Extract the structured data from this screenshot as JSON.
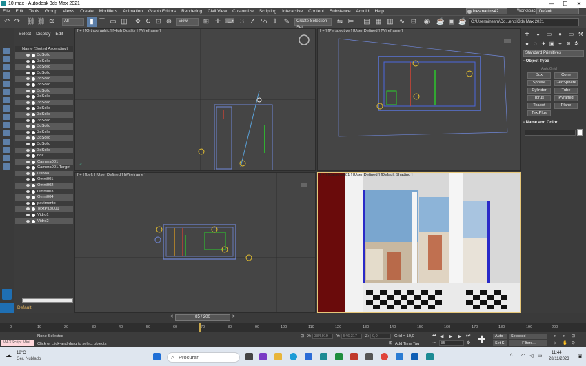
{
  "window": {
    "title": "10.max - Autodesk 3ds Max 2021",
    "minimize": "—",
    "maximize": "☐",
    "close": "✕"
  },
  "menu": [
    "File",
    "Edit",
    "Tools",
    "Group",
    "Views",
    "Create",
    "Modifiers",
    "Animation",
    "Graph Editors",
    "Rendering",
    "Civil View",
    "Customize",
    "Scripting",
    "Interactive",
    "Content",
    "Substance",
    "Arnold",
    "Help"
  ],
  "account": {
    "user": "inesmartins42",
    "workspaces_label": "Workspaces:",
    "workspace": "Default"
  },
  "toolbar": {
    "selection_filter": "All",
    "ref_coord": "View",
    "selection_set": "Create Selection Set",
    "project_path": "C:\\Users\\inesm\\Do...ents\\3ds Max 2021"
  },
  "explorer": {
    "tabs": [
      "Select",
      "Display",
      "Edit"
    ],
    "column_header": "Name (Sorted Ascending)",
    "items": [
      "3dSolid",
      "3dSolid",
      "3dSolid",
      "3dSolid",
      "3dSolid",
      "3dSolid",
      "3dSolid",
      "3dSolid",
      "3dSolid",
      "3dSolid",
      "3dSolid",
      "3dSolid",
      "3dSolid",
      "3dSolid",
      "3dSolid",
      "3dSolid",
      "3dSolid",
      "box",
      "Camera001",
      "Camera001.Target",
      "Lisboa",
      "Omni001",
      "Omni002",
      "Omni003",
      "Omni004",
      "pavimento",
      "TextPlus001",
      "Vidro1",
      "Vidro2"
    ],
    "layer": "Default"
  },
  "viewports": {
    "top_left": "[ + ] [Orthographic ] [High Quality ] [Wireframe ]",
    "top_right": "[ + ] [Perspective ] [User Defined ] [Wireframe ]",
    "bottom_left": "[ + ] [Left ] [User Defined ] [Wireframe ]",
    "bottom_right": "[ + ] [Camera001 ] [User Defined ] [Default Shading ]"
  },
  "command_panel": {
    "category": "Standard Primitives",
    "object_type_title": "Object Type",
    "autogrid": "AutoGrid",
    "buttons": [
      "Box",
      "Cone",
      "Sphere",
      "GeoSphere",
      "Cylinder",
      "Tube",
      "Torus",
      "Pyramid",
      "Teapot",
      "Plane",
      "TextPlus"
    ],
    "name_color_title": "Name and Color"
  },
  "timeline": {
    "slider": "85 / 200",
    "ticks": [
      "0",
      "10",
      "20",
      "30",
      "40",
      "50",
      "60",
      "70",
      "80",
      "90",
      "100",
      "110",
      "120",
      "130",
      "140",
      "150",
      "160",
      "170",
      "180",
      "190",
      "200"
    ]
  },
  "status": {
    "maxscript": "MAXScript Mini",
    "selection": "None Selected",
    "prompt": "Click or click-and-drag to select objects",
    "x_label": "X:",
    "x_value": "384,919",
    "y_label": "Y:",
    "y_value": "546,317",
    "z_label": "Z:",
    "z_value": "0,0",
    "grid": "Grid = 10,0",
    "add_time_tag": "Add Time Tag",
    "frame": "85",
    "auto": "Auto",
    "selected_dd": "Selected",
    "set_k": "Set K.",
    "filters": "Filters..."
  },
  "taskbar": {
    "temperature": "18°C",
    "weather": "Ger. Nublado",
    "search_placeholder": "Procurar",
    "time": "11:44",
    "date": "28/11/2023"
  },
  "colors": {
    "accent": "#5d7fa8",
    "viewport_bg": "#454545",
    "active_border": "#e6c77a",
    "taskbar": "#dfe6ef"
  }
}
